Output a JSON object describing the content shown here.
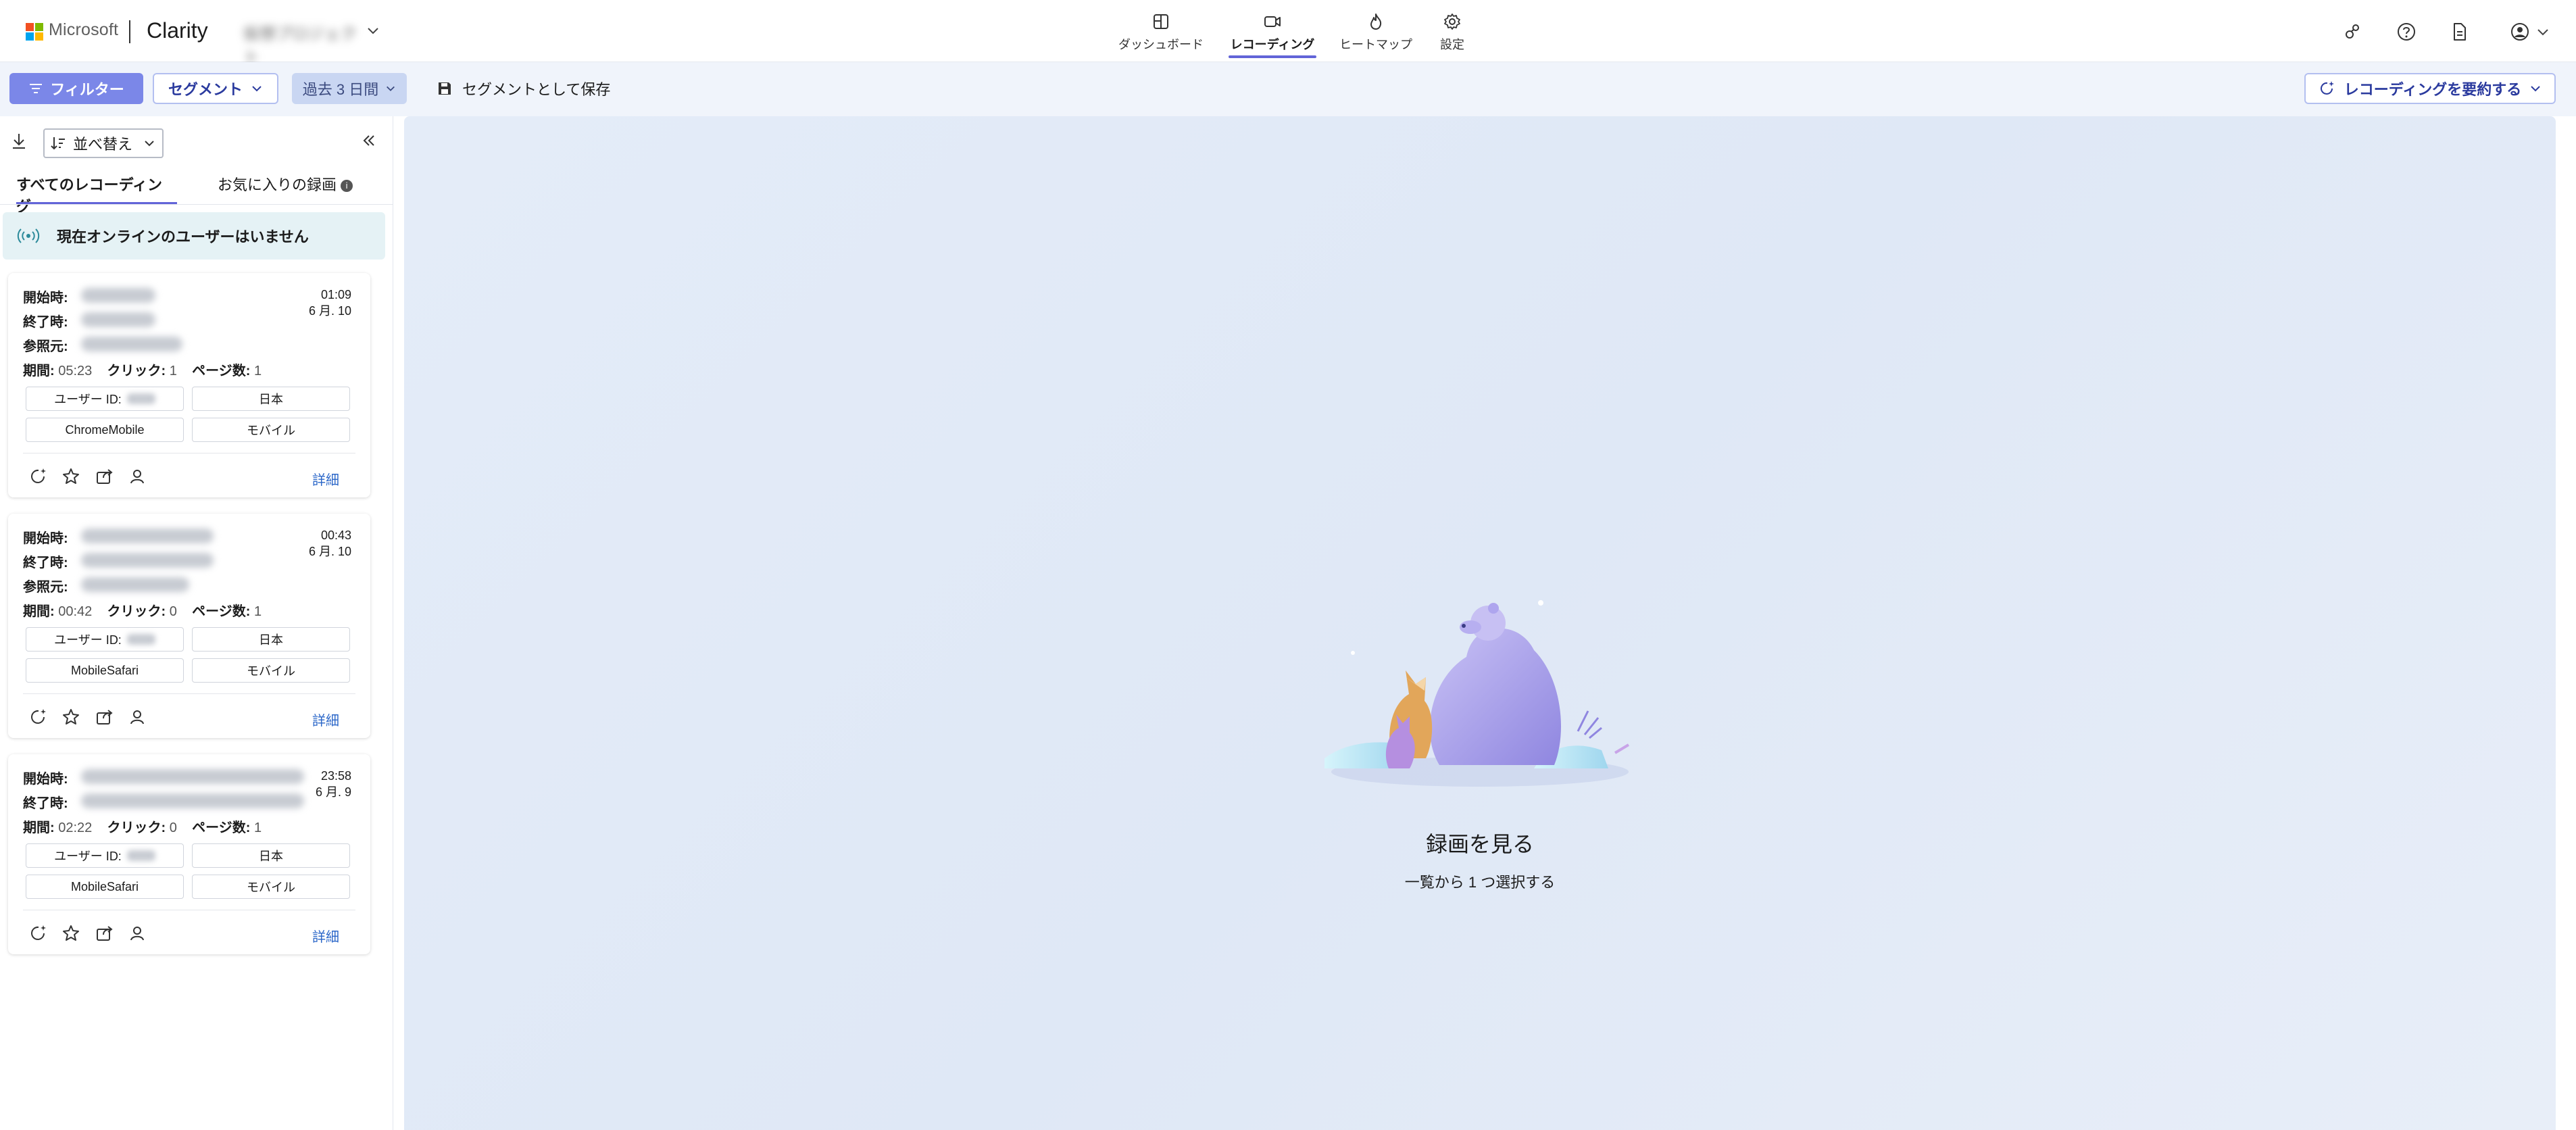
{
  "header": {
    "ms_brand": "Microsoft",
    "app_name": "Clarity",
    "project_name": "仮想プロジェクト",
    "nav": [
      {
        "label": "ダッシュボード",
        "icon": "dashboard-icon"
      },
      {
        "label": "レコーディング",
        "icon": "video-icon",
        "active": true
      },
      {
        "label": "ヒートマップ",
        "icon": "flame-icon"
      },
      {
        "label": "設定",
        "icon": "gear-icon"
      }
    ],
    "right_icons": [
      "share-users-icon",
      "help-icon",
      "document-icon",
      "account-icon"
    ]
  },
  "toolbar": {
    "filter_label": "フィルター",
    "segment_label": "セグメント",
    "date_label": "過去 3 日間",
    "save_segment_label": "セグメントとして保存",
    "summarize_label": "レコーディングを要約する"
  },
  "sidebar": {
    "sort_label": "並べ替え",
    "tabs": [
      {
        "label": "すべてのレコーディング",
        "active": true
      },
      {
        "label": "お気に入りの録画",
        "info": "i"
      }
    ],
    "online_banner": "現在オンラインのユーザーはいません",
    "labels": {
      "start": "開始時:",
      "end": "終了時:",
      "referrer": "参照元:",
      "duration": "期間:",
      "clicks": "クリック:",
      "pages": "ページ数:",
      "user_id": "ユーザー ID:",
      "detail": "詳細"
    },
    "cards": [
      {
        "time": "01:09",
        "date": "6 月. 10",
        "duration": "05:23",
        "clicks": "1",
        "pages": "1",
        "country": "日本",
        "browser": "ChromeMobile",
        "device": "モバイル",
        "has_referrer": true
      },
      {
        "time": "00:43",
        "date": "6 月. 10",
        "duration": "00:42",
        "clicks": "0",
        "pages": "1",
        "country": "日本",
        "browser": "MobileSafari",
        "device": "モバイル",
        "has_referrer": true
      },
      {
        "time": "23:58",
        "date": "6 月. 9",
        "duration": "02:22",
        "clicks": "0",
        "pages": "1",
        "country": "日本",
        "browser": "MobileSafari",
        "device": "モバイル",
        "has_referrer": false
      }
    ]
  },
  "main": {
    "empty_title": "録画を見る",
    "empty_subtitle": "一覧から 1 つ選択する"
  },
  "colors": {
    "accent": "#6264d8",
    "filter_button": "#7b87e8",
    "link": "#2a66c8",
    "main_bg": "#e4ecf8",
    "online_banner_bg": "#e5f2f5"
  }
}
